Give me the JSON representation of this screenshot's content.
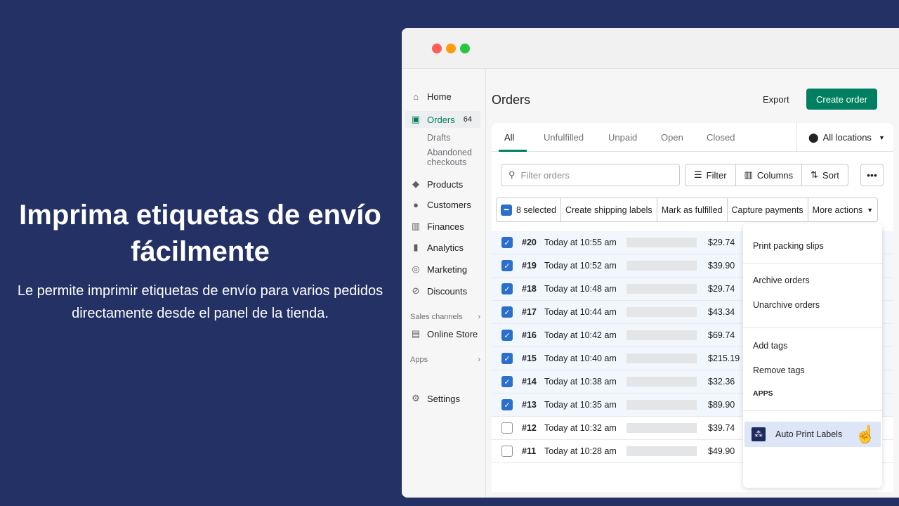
{
  "hero": {
    "title": "Imprima etiquetas de envío fácilmente",
    "subtitle": "Le permite imprimir etiquetas de envío para varios pedidos directamente desde el panel de la tienda."
  },
  "window_colors": {
    "close": "#fe5f57",
    "minimize": "#fd9c0b",
    "maximize": "#27c840"
  },
  "sidebar": {
    "home": "Home",
    "orders": "Orders",
    "orders_count": "64",
    "drafts": "Drafts",
    "abandoned": "Abandoned checkouts",
    "products": "Products",
    "customers": "Customers",
    "finances": "Finances",
    "analytics": "Analytics",
    "marketing": "Marketing",
    "discounts": "Discounts",
    "sales_channels": "Sales channels",
    "online_store": "Online Store",
    "apps": "Apps",
    "settings": "Settings"
  },
  "header": {
    "title": "Orders",
    "export": "Export",
    "create": "Create order"
  },
  "tabs": [
    "All",
    "Unfulfilled",
    "Unpaid",
    "Open",
    "Closed"
  ],
  "locations": "All locations",
  "toolbar": {
    "filter_placeholder": "Filter orders",
    "filter": "Filter",
    "columns": "Columns",
    "sort": "Sort"
  },
  "bulk": {
    "selected": "8 selected",
    "shipping": "Create shipping labels",
    "fulfilled": "Mark as fulfilled",
    "capture": "Capture payments",
    "more": "More actions"
  },
  "orders": [
    {
      "num": "#20",
      "date": "Today at 10:55 am",
      "price": "$29.74",
      "checked": true
    },
    {
      "num": "#19",
      "date": "Today at 10:52 am",
      "price": "$39.90",
      "checked": true
    },
    {
      "num": "#18",
      "date": "Today at 10:48 am",
      "price": "$29.74",
      "checked": true
    },
    {
      "num": "#17",
      "date": "Today at 10:44 am",
      "price": "$43.34",
      "checked": true
    },
    {
      "num": "#16",
      "date": "Today at 10:42 am",
      "price": "$69.74",
      "checked": true
    },
    {
      "num": "#15",
      "date": "Today at 10:40 am",
      "price": "$215.19",
      "checked": true
    },
    {
      "num": "#14",
      "date": "Today at 10:38 am",
      "price": "$32.36",
      "checked": true
    },
    {
      "num": "#13",
      "date": "Today at 10:35 am",
      "price": "$89.90",
      "checked": true
    },
    {
      "num": "#12",
      "date": "Today at 10:32 am",
      "price": "$39.74",
      "checked": false
    },
    {
      "num": "#11",
      "date": "Today at 10:28 am",
      "price": "$49.90",
      "checked": false
    }
  ],
  "menu": {
    "packing": "Print packing slips",
    "archive": "Archive orders",
    "unarchive": "Unarchive orders",
    "add_tags": "Add tags",
    "remove_tags": "Remove tags",
    "apps_header": "APPS",
    "app": "Auto Print Labels"
  }
}
